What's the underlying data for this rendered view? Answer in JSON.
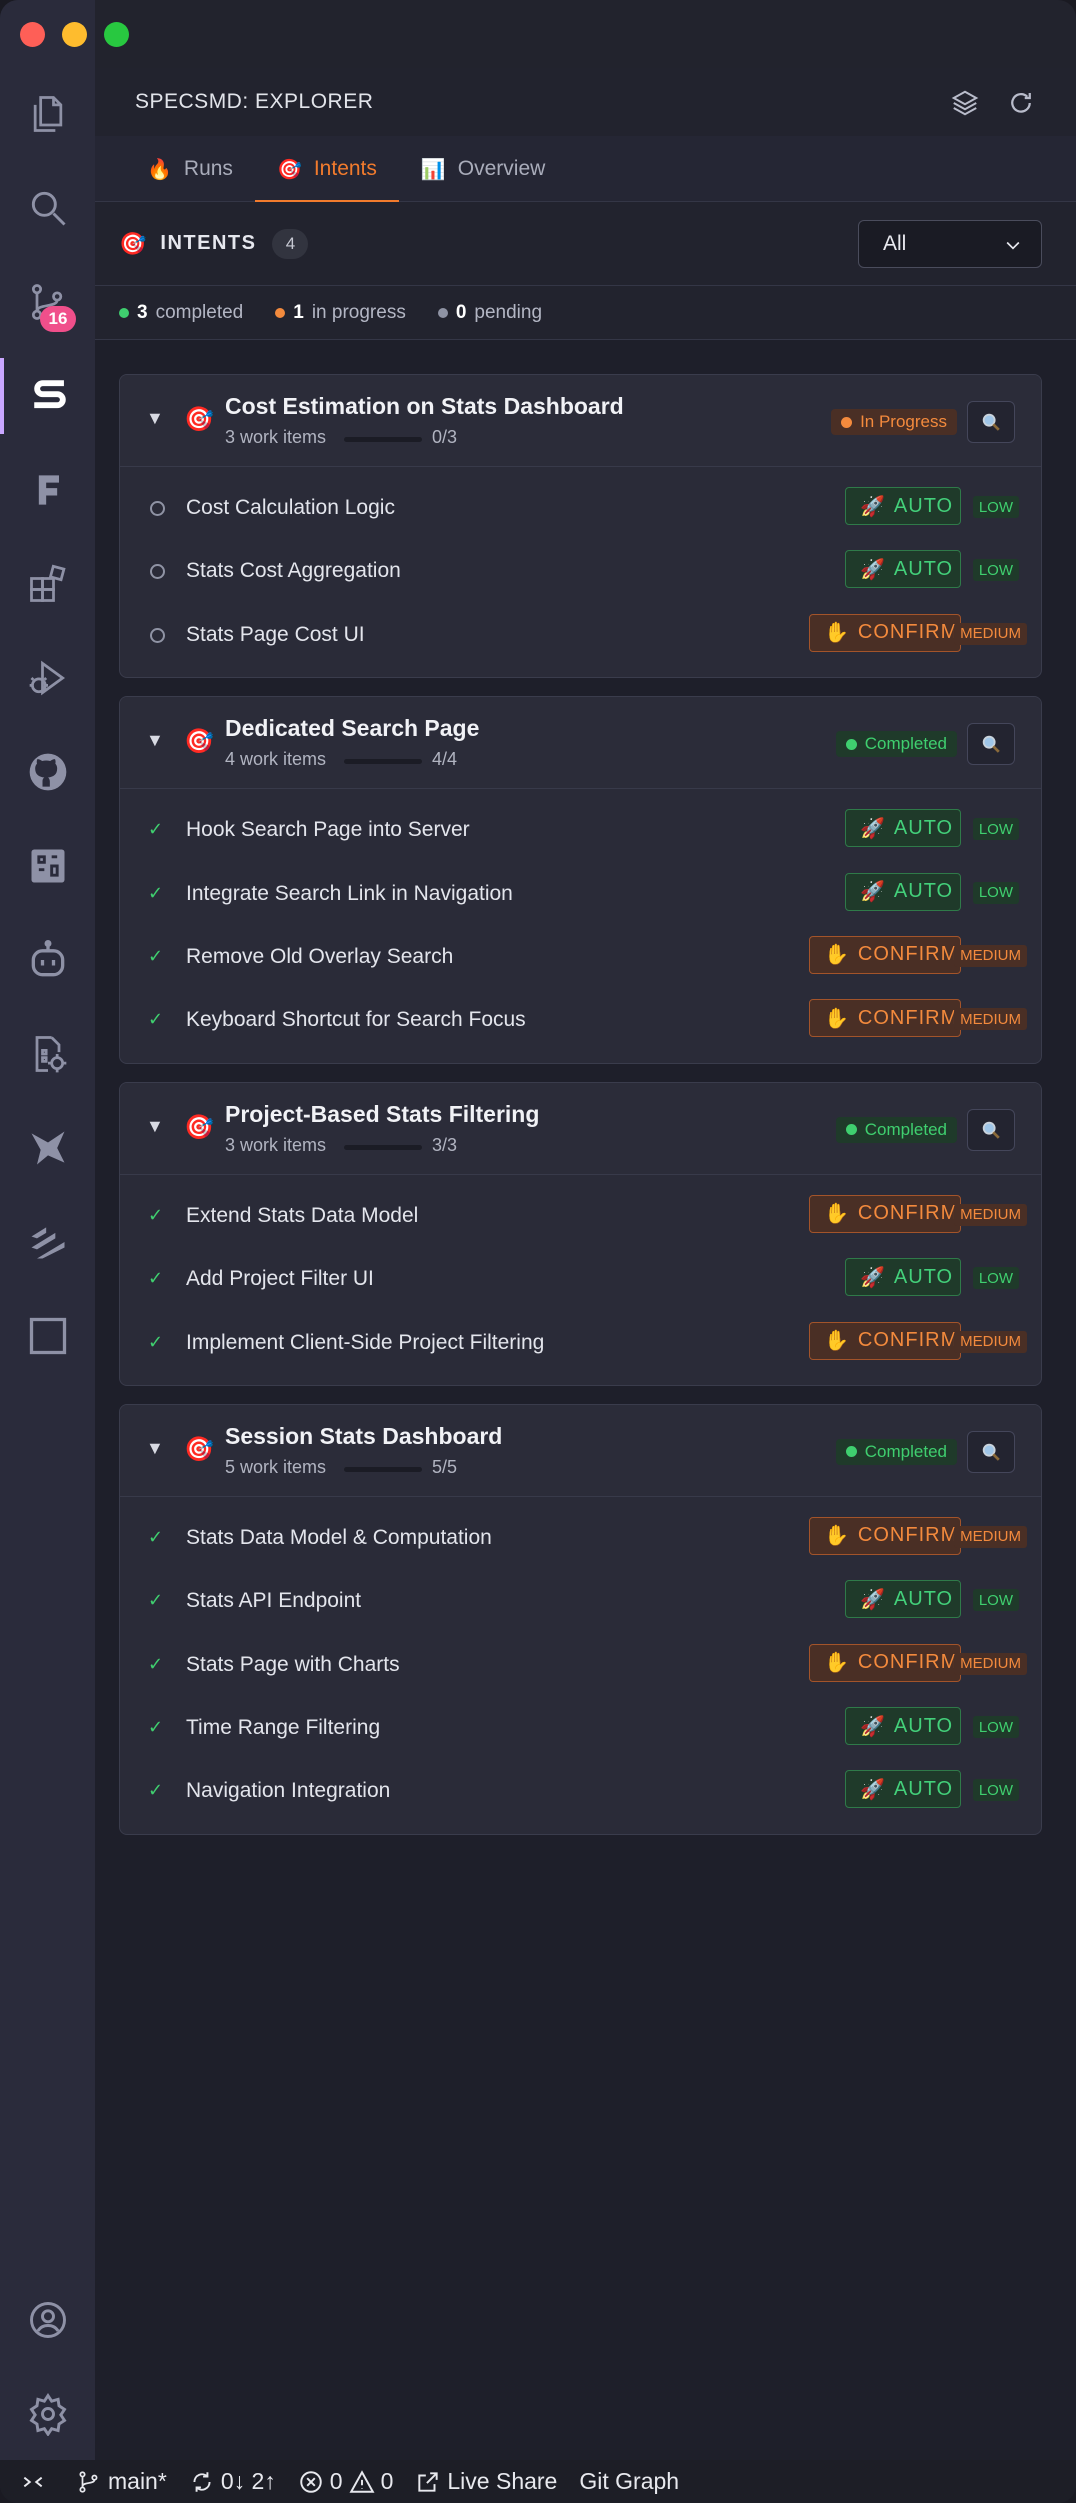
{
  "panel": {
    "title": "SPECSMD: EXPLORER"
  },
  "activity_bar": {
    "source_control_badge": "16"
  },
  "tabs": [
    {
      "emoji": "🔥",
      "label": "Runs"
    },
    {
      "emoji": "🎯",
      "label": "Intents"
    },
    {
      "emoji": "📊",
      "label": "Overview"
    }
  ],
  "intents": {
    "label": "INTENTS",
    "count": "4",
    "filter_value": "All",
    "emoji": "🎯"
  },
  "summary": {
    "completed_count": "3",
    "completed_label": "completed",
    "in_progress_count": "1",
    "in_progress_label": "in progress",
    "pending_count": "0",
    "pending_label": "pending"
  },
  "colors": {
    "accent": "#f27b2d",
    "green": "#3fcf6f",
    "orange": "#f38a3d",
    "pending": "#8f93a4"
  },
  "cards": [
    {
      "title": "Cost Estimation on Stats Dashboard",
      "sub": "3 work items",
      "progress_text": "0/3",
      "progress": 0,
      "status": "In Progress",
      "items": [
        {
          "label": "Cost Calculation Logic",
          "done": false,
          "mode": "AUTO",
          "level": "LOW"
        },
        {
          "label": "Stats Cost Aggregation",
          "done": false,
          "mode": "AUTO",
          "level": "LOW"
        },
        {
          "label": "Stats Page Cost UI",
          "done": false,
          "mode": "CONFIRM",
          "level": "MEDIUM"
        }
      ]
    },
    {
      "title": "Dedicated Search Page",
      "sub": "4 work items",
      "progress_text": "4/4",
      "progress": 1,
      "status": "Completed",
      "items": [
        {
          "label": "Hook Search Page into Server",
          "done": true,
          "mode": "AUTO",
          "level": "LOW"
        },
        {
          "label": "Integrate Search Link in Navigation",
          "done": true,
          "mode": "AUTO",
          "level": "LOW"
        },
        {
          "label": "Remove Old Overlay Search",
          "done": true,
          "mode": "CONFIRM",
          "level": "MEDIUM"
        },
        {
          "label": "Keyboard Shortcut for Search Focus",
          "done": true,
          "mode": "CONFIRM",
          "level": "MEDIUM"
        }
      ]
    },
    {
      "title": "Project-Based Stats Filtering",
      "sub": "3 work items",
      "progress_text": "3/3",
      "progress": 1,
      "status": "Completed",
      "items": [
        {
          "label": "Extend Stats Data Model",
          "done": true,
          "mode": "CONFIRM",
          "level": "MEDIUM"
        },
        {
          "label": "Add Project Filter UI",
          "done": true,
          "mode": "AUTO",
          "level": "LOW"
        },
        {
          "label": "Implement Client-Side Project Filtering",
          "done": true,
          "mode": "CONFIRM",
          "level": "MEDIUM"
        }
      ]
    },
    {
      "title": "Session Stats Dashboard",
      "sub": "5 work items",
      "progress_text": "5/5",
      "progress": 1,
      "status": "Completed",
      "items": [
        {
          "label": "Stats Data Model & Computation",
          "done": true,
          "mode": "CONFIRM",
          "level": "MEDIUM"
        },
        {
          "label": "Stats API Endpoint",
          "done": true,
          "mode": "AUTO",
          "level": "LOW"
        },
        {
          "label": "Stats Page with Charts",
          "done": true,
          "mode": "CONFIRM",
          "level": "MEDIUM"
        },
        {
          "label": "Time Range Filtering",
          "done": true,
          "mode": "AUTO",
          "level": "LOW"
        },
        {
          "label": "Navigation Integration",
          "done": true,
          "mode": "AUTO",
          "level": "LOW"
        }
      ]
    }
  ],
  "mode_icons": {
    "AUTO": "🚀",
    "CONFIRM": "✋"
  },
  "statusbar": {
    "branch": "main*",
    "sync": "0↓ 2↑",
    "errors": "0",
    "warnings": "0",
    "live_share": "Live Share",
    "git_graph": "Git Graph"
  }
}
